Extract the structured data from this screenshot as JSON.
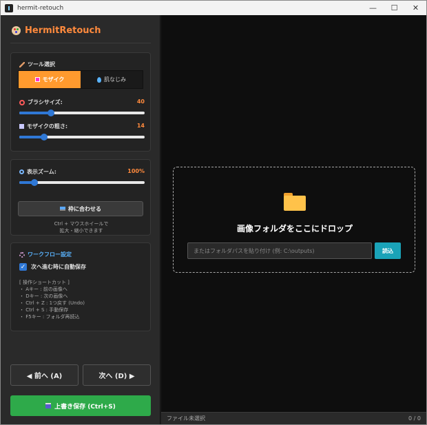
{
  "window": {
    "title": "hermit-retouch",
    "controls": {
      "minimize": "—",
      "maximize": "☐",
      "close": "✕"
    }
  },
  "sidebar": {
    "brand": "HermitRetouch",
    "tools": {
      "section_label": "ツール選択",
      "tabs": [
        {
          "label": "モザイク",
          "active": true
        },
        {
          "label": "肌なじみ",
          "active": false
        }
      ]
    },
    "brush_size": {
      "label": "ブラシサイズ:",
      "value": "40",
      "fraction": 0.25
    },
    "mosaic_coarseness": {
      "label": "モザイクの粗さ:",
      "value": "14",
      "fraction": 0.2
    },
    "zoom": {
      "label": "表示ズーム:",
      "value": "100%",
      "fraction": 0.12
    },
    "fit_button": "枠に合わせる",
    "zoom_hint_line1": "Ctrl + マウスホイールで",
    "zoom_hint_line2": "拡大・縮小できます",
    "workflow": {
      "title": "ワークフロー設定",
      "autosave_label": "次へ進む時に自動保存",
      "autosave_checked": true,
      "shortcuts_title": "[ 操作ショートカット ]",
      "shortcuts": [
        "・ Aキー : 前の画像へ",
        "・ Dキー : 次の画像へ",
        "・ Ctrl + Z : 1つ戻す (Undo)",
        "・ Ctrl + S : 手動保存",
        "・ F5キー : フォルダ再読込"
      ]
    },
    "prev_button": "◀ 前へ (A)",
    "next_button": "次へ (D) ▶",
    "save_button": "上書き保存 (Ctrl+S)"
  },
  "main": {
    "drop_title": "画像フォルダをここにドロップ",
    "path_placeholder": "またはフォルダパスを貼り付け (例: C:\\outputs)",
    "load_button": "読込"
  },
  "status": {
    "file": "ファイル未選択",
    "count": "0 / 0"
  },
  "colors": {
    "accent": "#ff9a2e",
    "slider": "#2f78d6",
    "save": "#2eaa4a",
    "load": "#1aa3b8"
  }
}
